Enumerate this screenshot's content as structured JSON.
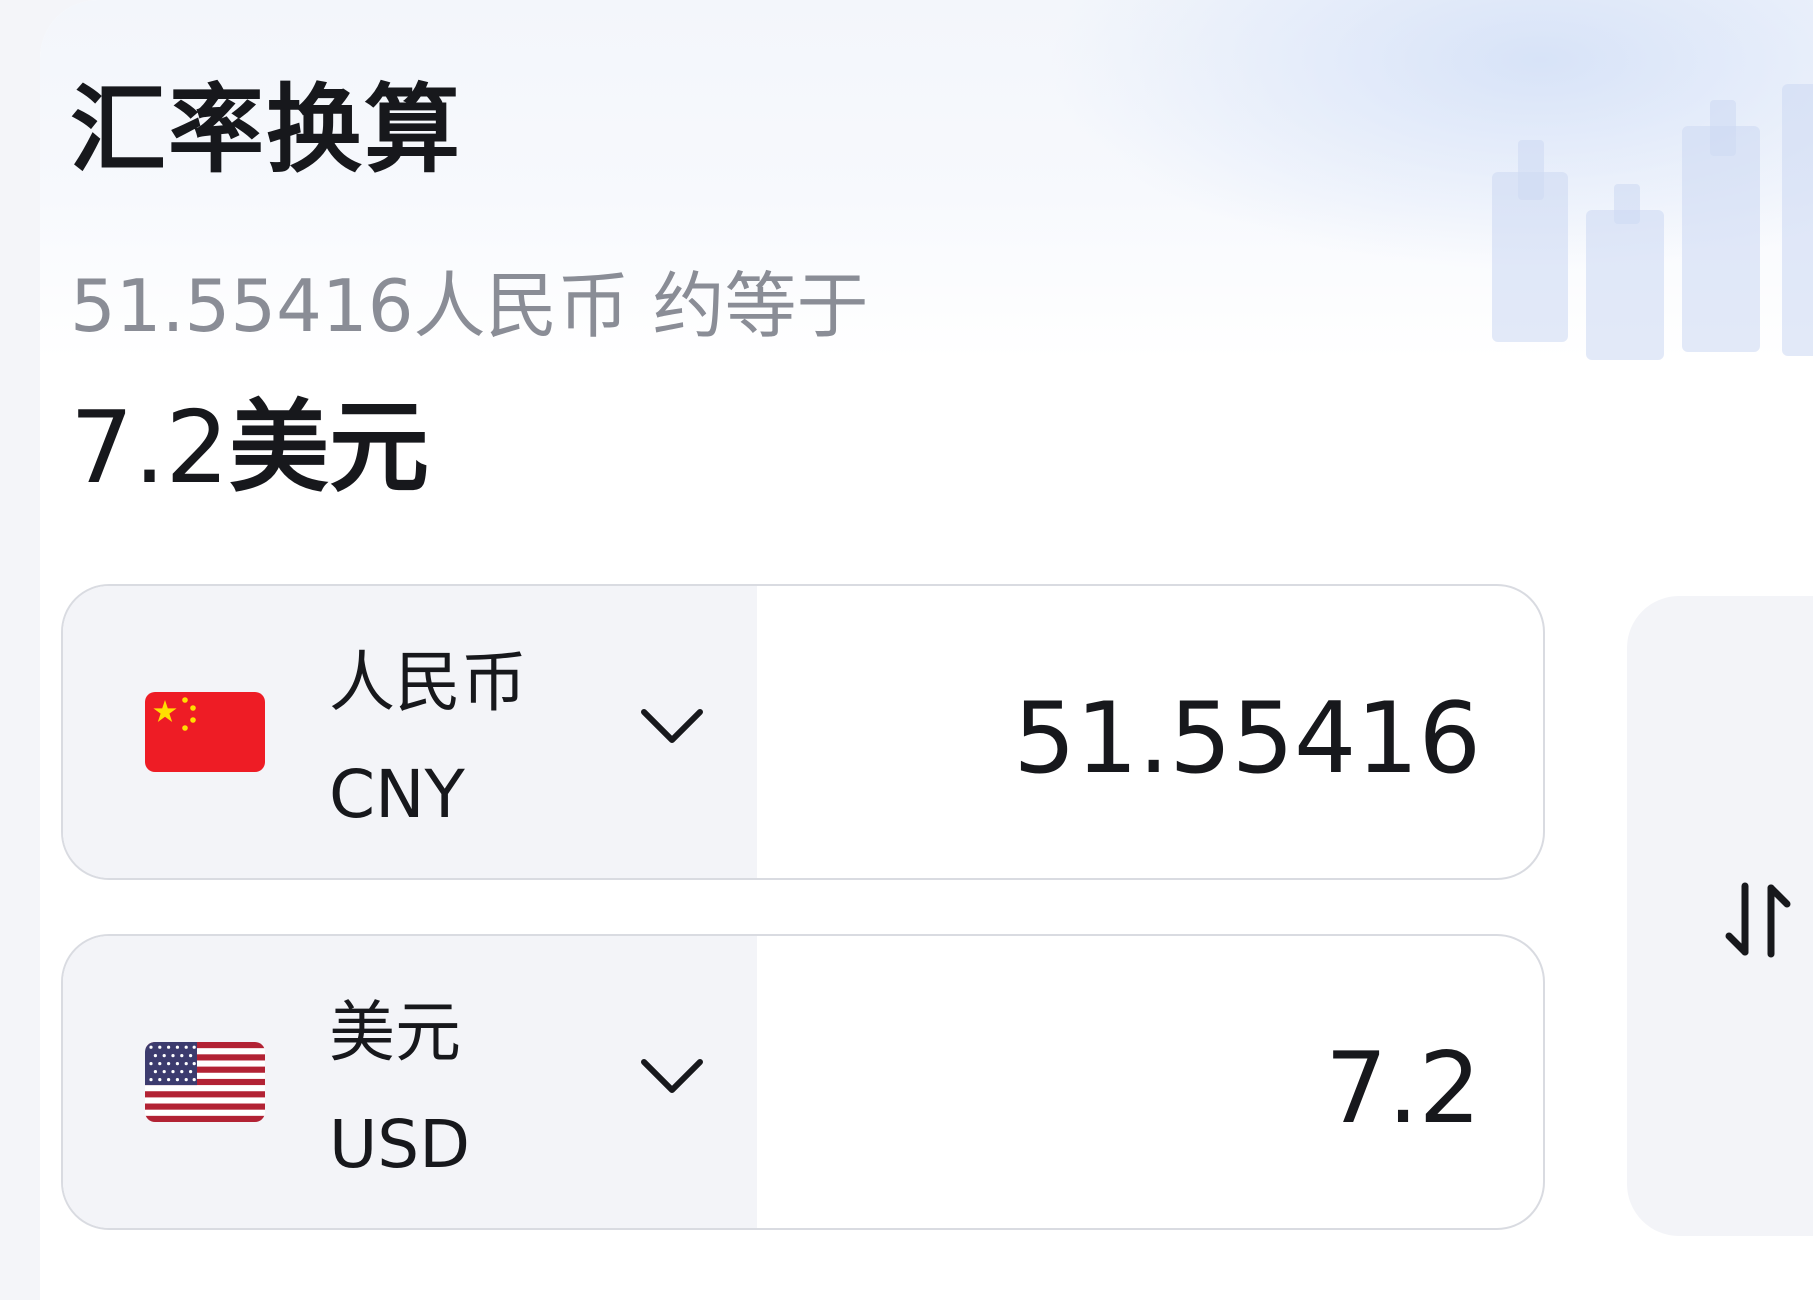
{
  "title": "汇率换算",
  "summary": {
    "from_amount": "51.55416",
    "from_name": "人民币",
    "phrase": "约等于"
  },
  "result": {
    "amount": "7.2",
    "unit": "美元"
  },
  "rows": [
    {
      "flag_icon": "china-flag-icon",
      "name": "人民币",
      "code": "CNY",
      "amount": "51.55416"
    },
    {
      "flag_icon": "usa-flag-icon",
      "name": "美元",
      "code": "USD",
      "amount": "7.2"
    }
  ],
  "swap_icon": "swap-arrows-icon",
  "colors": {
    "title": "#17181c",
    "subtle_text": "#8a8d96",
    "picker_bg": "#f3f4f8",
    "border": "#d9dbe1"
  }
}
